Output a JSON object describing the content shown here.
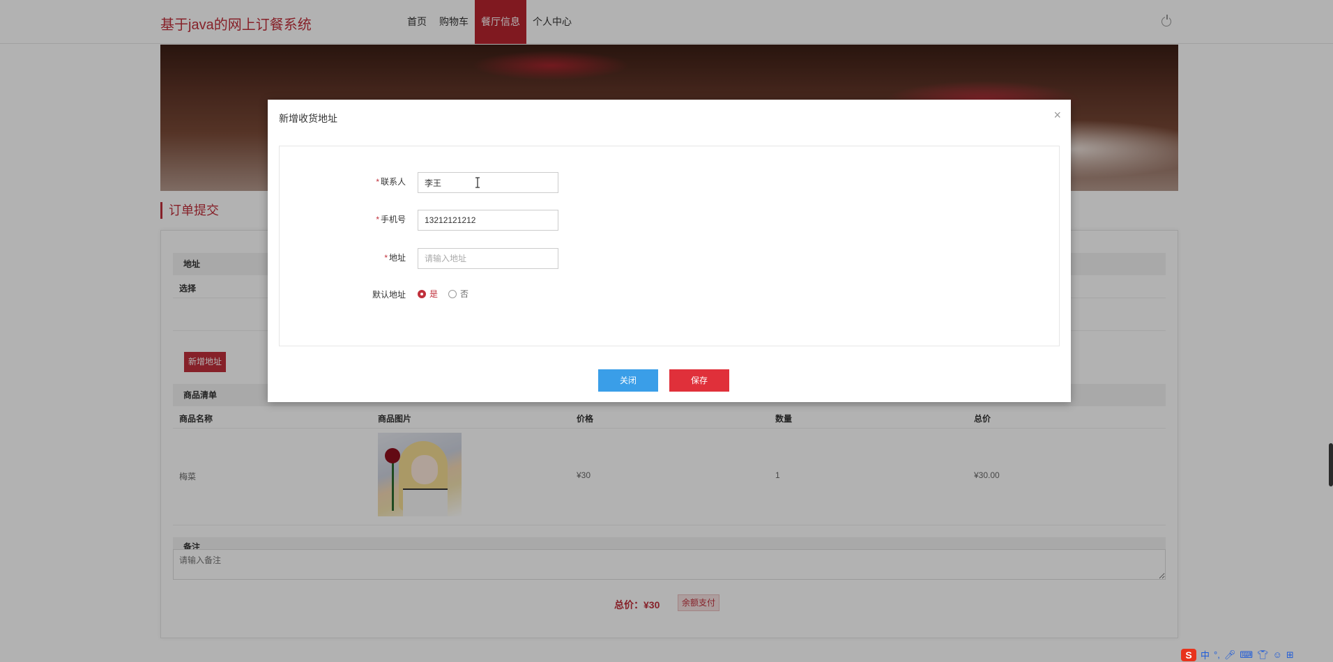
{
  "header": {
    "logo": "基于java的网上订餐系统",
    "nav": [
      "首页",
      "购物车",
      "餐厅信息",
      "个人中心"
    ],
    "active_nav": "餐厅信息"
  },
  "order": {
    "section_title": "订单提交",
    "address_header": "地址",
    "address_col_select": "选择",
    "add_address_button": "新增地址",
    "products_header": "商品清单",
    "columns": [
      "商品名称",
      "商品图片",
      "价格",
      "数量",
      "总价"
    ],
    "rows": [
      {
        "name": "梅菜",
        "price": "¥30",
        "quantity": "1",
        "total": "¥30.00"
      }
    ],
    "remark_label": "备注",
    "remark_placeholder": "请输入备注",
    "total_label": "总价：",
    "total_value": "¥30",
    "pay_button": "余额支付"
  },
  "modal": {
    "title": "新增收货地址",
    "close_icon": "×",
    "fields": {
      "contact": {
        "label": "联系人",
        "value": "李王"
      },
      "phone": {
        "label": "手机号",
        "value": "13212121212"
      },
      "address": {
        "label": "地址",
        "placeholder": "请输入地址"
      },
      "default": {
        "label": "默认地址",
        "options": [
          "是",
          "否"
        ],
        "selected": "是"
      }
    },
    "required_mark": "*",
    "cancel_button": "关闭",
    "save_button": "保存"
  },
  "taskbar": {
    "ime_logo": "S",
    "ime_mode": "中"
  },
  "colors": {
    "brand": "#c0303b",
    "cancel": "#3a9ee8",
    "save": "#e0303a"
  }
}
